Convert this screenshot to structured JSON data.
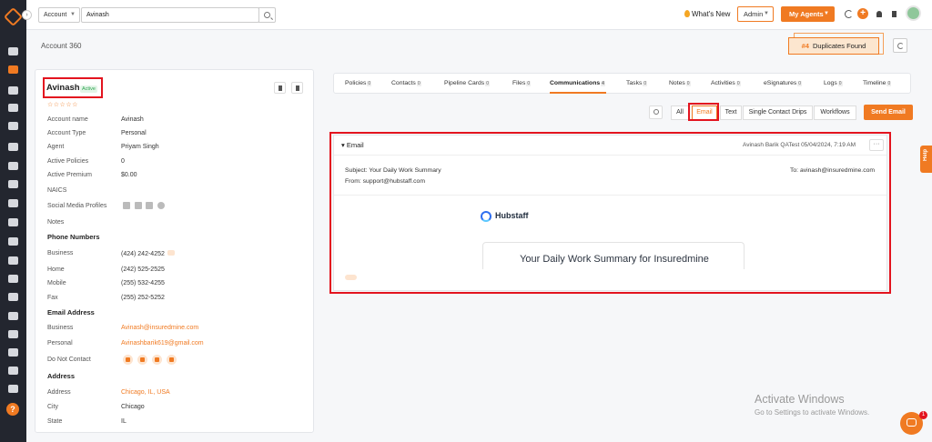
{
  "header": {
    "account_select": "Account",
    "search_value": "Avinash",
    "whats_new": "What's New",
    "role_select": "Admin",
    "my_agents": "My Agents"
  },
  "page": {
    "title": "Account 360",
    "duplicates": {
      "count": "#4",
      "label": "Duplicates Found"
    }
  },
  "profile": {
    "name": "Avinash",
    "status": "Active",
    "stars": "☆☆☆☆☆",
    "fields": [
      {
        "label": "Account name",
        "value": "Avinash"
      },
      {
        "label": "Account Type",
        "value": "Personal"
      },
      {
        "label": "Agent",
        "value": "Priyam Singh"
      },
      {
        "label": "Active Policies",
        "value": "0"
      },
      {
        "label": "Active Premium",
        "value": "$0.00"
      },
      {
        "label": "NAICS",
        "value": ""
      },
      {
        "label": "Social Media Profiles",
        "value": ""
      },
      {
        "label": "Notes",
        "value": ""
      }
    ],
    "phone_section": "Phone Numbers",
    "phones": [
      {
        "label": "Business",
        "value": "(424) 242-4252"
      },
      {
        "label": "Home",
        "value": "(242) 525-2525"
      },
      {
        "label": "Mobile",
        "value": "(255) 532-4255"
      },
      {
        "label": "Fax",
        "value": "(255) 252-5252"
      }
    ],
    "email_section": "Email Address",
    "emails": [
      {
        "label": "Business",
        "value": "Avinash@insuredmine.com"
      },
      {
        "label": "Personal",
        "value": "Avinashbarik619@gmail.com"
      }
    ],
    "do_not_contact": "Do Not Contact",
    "address_section": "Address",
    "address": [
      {
        "label": "Address",
        "value": "Chicago, IL, USA"
      },
      {
        "label": "City",
        "value": "Chicago"
      },
      {
        "label": "State",
        "value": "IL"
      }
    ]
  },
  "tabs": [
    {
      "label": "Policies",
      "count": "0"
    },
    {
      "label": "Contacts",
      "count": "0"
    },
    {
      "label": "Pipeline Cards",
      "count": "0"
    },
    {
      "label": "Files",
      "count": "0"
    },
    {
      "label": "Communications",
      "count": "4"
    },
    {
      "label": "Tasks",
      "count": "0"
    },
    {
      "label": "Notes",
      "count": "0"
    },
    {
      "label": "Activities",
      "count": "0"
    },
    {
      "label": "eSignatures",
      "count": "0"
    },
    {
      "label": "Logs",
      "count": "0"
    },
    {
      "label": "Timeline",
      "count": "0"
    }
  ],
  "filters": [
    "All",
    "Email",
    "Text",
    "Single Contact Drips",
    "Workflows"
  ],
  "send_email": "Send Email",
  "email": {
    "title": "Email",
    "meta": "Avinash Barik QATest 05/04/2024, 7:19 AM",
    "more": "···",
    "subject": "Subject: Your Daily Work Summary",
    "from": "From: support@hubstaff.com",
    "to": "To: avinash@insuredmine.com",
    "brand": "Hubstaff",
    "summary": "Your Daily Work Summary for Insuredmine"
  },
  "help_tab": "Help",
  "watermark": {
    "line1": "Activate Windows",
    "line2": "Go to Settings to activate Windows."
  },
  "chat_badge": "1",
  "colors": {
    "accent": "#f07a22",
    "highlight": "#e3141f",
    "sidebar": "#23262f"
  }
}
